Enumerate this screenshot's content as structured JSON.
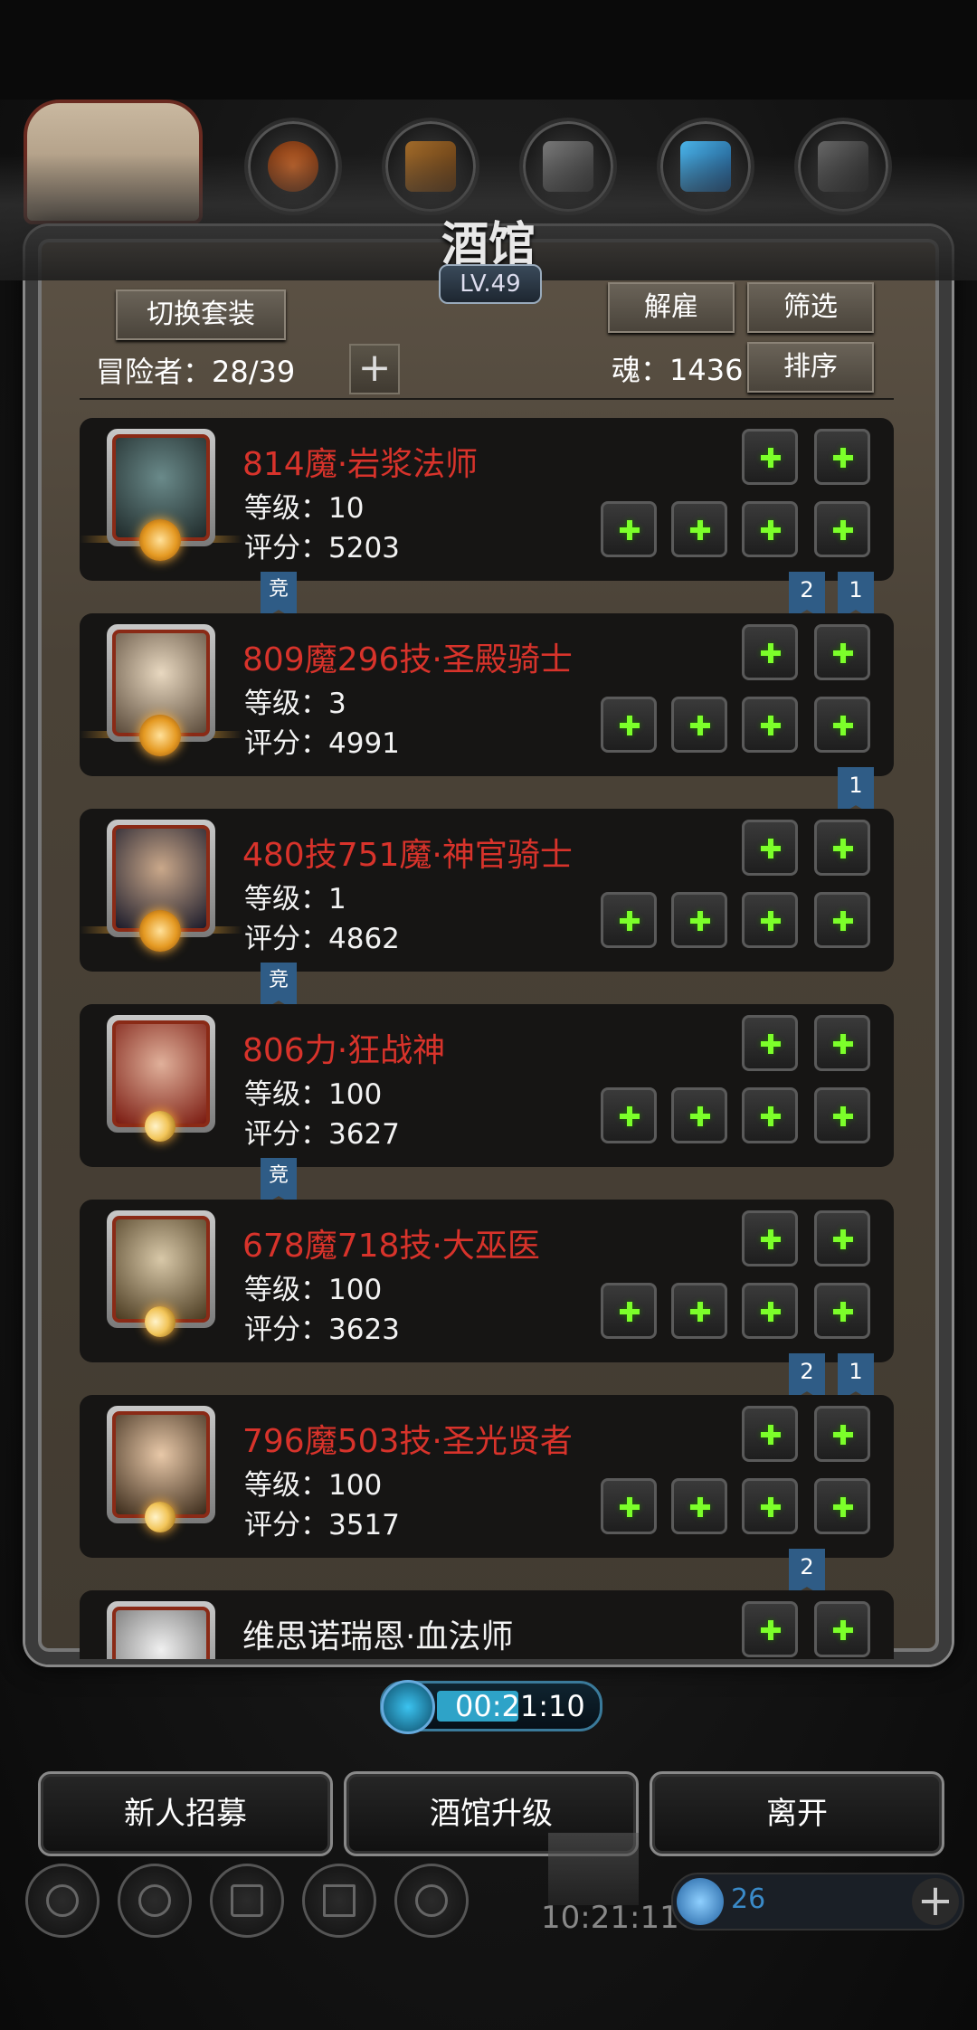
{
  "header": {
    "title": "酒馆",
    "level": "LV.49",
    "switch_outfit_label": "切换套装",
    "dismiss_label": "解雇",
    "filter_label": "筛选",
    "sort_label": "排序",
    "adventurers_label": "冒险者：28/39",
    "soul_label": "魂：1436",
    "add_slot_label": "+"
  },
  "heroes": [
    {
      "name": "814魔·岩浆法师",
      "level": "等级：10",
      "score": "评分：5203",
      "emblem": "sun-emblem",
      "name_color": "#d8332b"
    },
    {
      "name": "809魔296技·圣殿骑士",
      "level": "等级：3",
      "score": "评分：4991",
      "emblem": "sun-emblem",
      "name_color": "#d8332b"
    },
    {
      "name": "480技751魔·神官骑士",
      "level": "等级：1",
      "score": "评分：4862",
      "emblem": "sun-emblem",
      "name_color": "#d8332b"
    },
    {
      "name": "806力·狂战神",
      "level": "等级：100",
      "score": "评分：3627",
      "emblem": "moon-emblem",
      "name_color": "#d8332b"
    },
    {
      "name": "678魔718技·大巫医",
      "level": "等级：100",
      "score": "评分：3623",
      "emblem": "moon-emblem",
      "name_color": "#d8332b"
    },
    {
      "name": "796魔503技·圣光贤者",
      "level": "等级：100",
      "score": "评分：3517",
      "emblem": "moon-emblem",
      "name_color": "#d8332b"
    },
    {
      "name": "维思诺瑞恩·血法师",
      "level": "",
      "score": "",
      "emblem": "none",
      "name_color": "#f2f2f2"
    }
  ],
  "ribbons": {
    "competitive": "竞",
    "r1_a": "2",
    "r1_b": "1",
    "r2_a": "1",
    "r5_a": "2",
    "r5_b": "1",
    "r6_a": "2"
  },
  "footer": {
    "timer": "00:21:10",
    "recruit_label": "新人招募",
    "upgrade_label": "酒馆升级",
    "leave_label": "离开",
    "clock": "10:21:11",
    "gems": "26",
    "add_gems": "+"
  },
  "colors": {
    "accent_red": "#d8332b",
    "slot_plus": "#7cff2a",
    "ribbon_blue": "#2f5c86"
  }
}
